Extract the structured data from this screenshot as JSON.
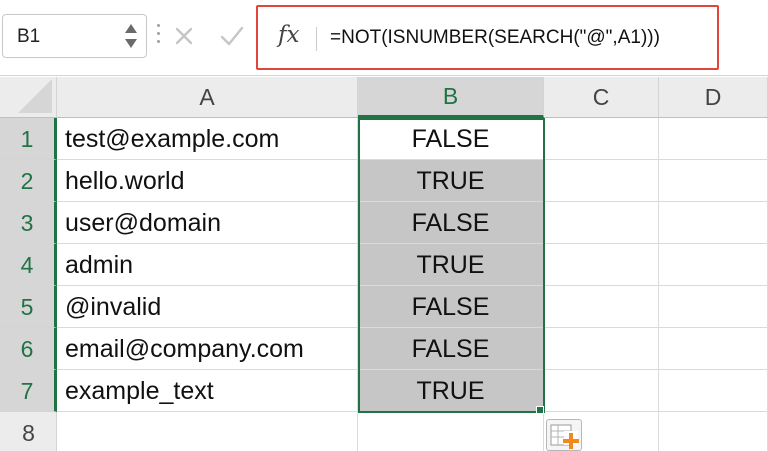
{
  "namebox": {
    "value": "B1"
  },
  "formula_bar": {
    "fx_label": "fx",
    "formula": "=NOT(ISNUMBER(SEARCH(\"@\",A1)))",
    "cancel_icon": "close-icon",
    "enter_icon": "checkmark-icon",
    "highlight_color": "#e0443a"
  },
  "columns": [
    "A",
    "B",
    "C",
    "D"
  ],
  "selected_column": "B",
  "rows": [
    "1",
    "2",
    "3",
    "4",
    "5",
    "6",
    "7",
    "8"
  ],
  "cells": {
    "A": [
      "test@example.com",
      "hello.world",
      "user@domain",
      "admin",
      "@invalid",
      "email@company.com",
      "example_text",
      ""
    ],
    "B": [
      "FALSE",
      "TRUE",
      "FALSE",
      "TRUE",
      "FALSE",
      "FALSE",
      "TRUE",
      ""
    ]
  },
  "selection": {
    "range": "B1:B7",
    "active_cell": "B1",
    "accent_color": "#217346"
  },
  "quick_analysis_icon": "quick-analysis-icon"
}
